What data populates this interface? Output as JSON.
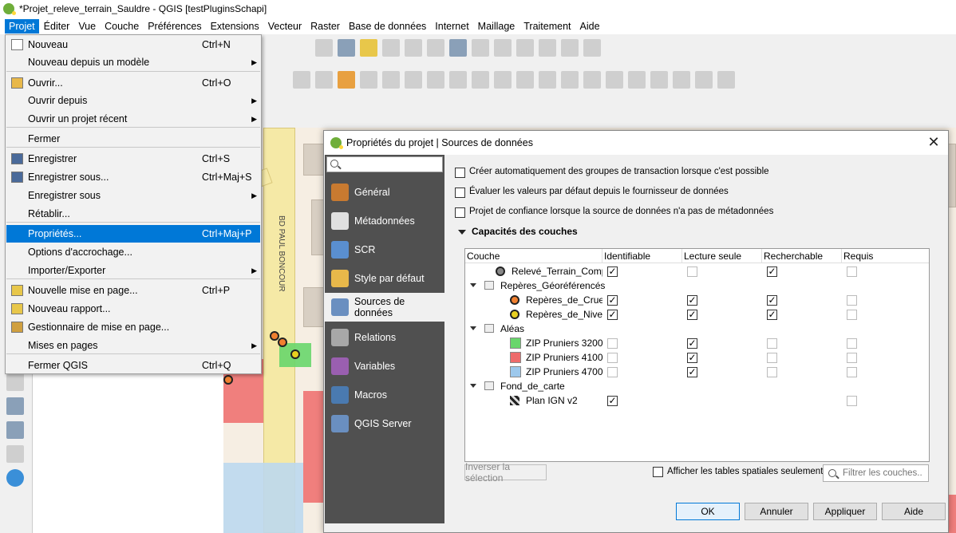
{
  "window": {
    "title": "*Projet_releve_terrain_Sauldre - QGIS [testPluginsSchapi]"
  },
  "menubar": [
    "Projet",
    "Éditer",
    "Vue",
    "Couche",
    "Préférences",
    "Extensions",
    "Vecteur",
    "Raster",
    "Base de données",
    "Internet",
    "Maillage",
    "Traitement",
    "Aide"
  ],
  "projet_menu": {
    "items": [
      {
        "label": "Nouveau",
        "shortcut": "Ctrl+N",
        "icon": "new-file-icon",
        "submenu": false
      },
      {
        "label": "Nouveau depuis un modèle",
        "shortcut": "",
        "icon": "",
        "submenu": true
      },
      {
        "label": "Ouvrir...",
        "shortcut": "Ctrl+O",
        "icon": "folder-icon",
        "submenu": false
      },
      {
        "label": "Ouvrir depuis",
        "shortcut": "",
        "icon": "",
        "submenu": true
      },
      {
        "label": "Ouvrir un projet récent",
        "shortcut": "",
        "icon": "",
        "submenu": true
      },
      {
        "label": "Fermer",
        "shortcut": "",
        "icon": "",
        "submenu": false
      },
      {
        "label": "Enregistrer",
        "shortcut": "Ctrl+S",
        "icon": "save-icon",
        "submenu": false
      },
      {
        "label": "Enregistrer sous...",
        "shortcut": "Ctrl+Maj+S",
        "icon": "save-as-icon",
        "submenu": false
      },
      {
        "label": "Enregistrer sous",
        "shortcut": "",
        "icon": "",
        "submenu": true
      },
      {
        "label": "Rétablir...",
        "shortcut": "",
        "icon": "",
        "submenu": false
      },
      {
        "label": "Propriétés...",
        "shortcut": "Ctrl+Maj+P",
        "icon": "",
        "submenu": false
      },
      {
        "label": "Options d'accrochage...",
        "shortcut": "",
        "icon": "",
        "submenu": false
      },
      {
        "label": "Importer/Exporter",
        "shortcut": "",
        "icon": "",
        "submenu": true
      },
      {
        "label": "Nouvelle mise en page...",
        "shortcut": "Ctrl+P",
        "icon": "layout-icon",
        "submenu": false
      },
      {
        "label": "Nouveau rapport...",
        "shortcut": "",
        "icon": "report-icon",
        "submenu": false
      },
      {
        "label": "Gestionnaire de mise en page...",
        "shortcut": "",
        "icon": "layout-manager-icon",
        "submenu": false
      },
      {
        "label": "Mises en pages",
        "shortcut": "",
        "icon": "",
        "submenu": true
      },
      {
        "label": "Fermer QGIS",
        "shortcut": "Ctrl+Q",
        "icon": "",
        "submenu": false
      }
    ]
  },
  "map": {
    "street_label": "BD PAUL BONCOUR"
  },
  "dialog": {
    "title": "Propriétés du projet | Sources de données",
    "sidebar": [
      {
        "label": "Général",
        "icon": "tools-icon",
        "color": "#c87a30"
      },
      {
        "label": "Métadonnées",
        "icon": "metadata-icon",
        "color": "#e0e0e0"
      },
      {
        "label": "SCR",
        "icon": "globe-icon",
        "color": "#5a8fd0"
      },
      {
        "label": "Style par défaut",
        "icon": "brush-icon",
        "color": "#e8b84a"
      },
      {
        "label": "Sources de données",
        "icon": "table-icon",
        "color": "#6a8fc0"
      },
      {
        "label": "Relations",
        "icon": "relations-icon",
        "color": "#a8a8a8"
      },
      {
        "label": "Variables",
        "icon": "variables-icon",
        "color": "#9a5fb0"
      },
      {
        "label": "Macros",
        "icon": "macros-icon",
        "color": "#4a7ab0"
      },
      {
        "label": "QGIS Server",
        "icon": "server-icon",
        "color": "#6a8fc0"
      }
    ],
    "options": [
      {
        "label": "Créer automatiquement des groupes de transaction lorsque c'est possible",
        "checked": false
      },
      {
        "label": "Évaluer les valeurs par défaut depuis le fournisseur de données",
        "checked": false
      },
      {
        "label": "Projet de confiance lorsque la source de données n'a pas de métadonnées",
        "checked": false
      }
    ],
    "section_title": "Capacités des couches",
    "columns": [
      "Couche",
      "Identifiable",
      "Lecture seule",
      "Recherchable",
      "Requis"
    ],
    "rows": [
      {
        "label": "Relevé_Terrain_Complet",
        "indent": 1,
        "type": "layer",
        "icon": "points-layer-icon",
        "color": "#888888",
        "id": true,
        "ro": false,
        "search": true,
        "req": false,
        "has_search": true
      },
      {
        "label": "Repères_Géoréférencés",
        "indent": 0,
        "type": "group",
        "icon": "group-icon",
        "color": "#888888"
      },
      {
        "label": "Repères_de_Crues",
        "indent": 2,
        "type": "layer",
        "icon": "orange-point-icon",
        "color": "#f08030",
        "id": true,
        "ro": true,
        "search": true,
        "req": false,
        "has_search": true
      },
      {
        "label": "Repères_de_Nivell...",
        "indent": 2,
        "type": "layer",
        "icon": "yellow-point-icon",
        "color": "#e8d020",
        "id": true,
        "ro": true,
        "search": true,
        "req": false,
        "has_search": true
      },
      {
        "label": "Aléas",
        "indent": 0,
        "type": "group",
        "icon": "group-icon",
        "color": "#888888"
      },
      {
        "label": "ZIP Pruniers 3200",
        "indent": 2,
        "type": "layer",
        "icon": "green-polygon-icon",
        "color": "#69d66c",
        "id": false,
        "ro": true,
        "search": false,
        "req": false,
        "has_search": true
      },
      {
        "label": "ZIP Pruniers 4100",
        "indent": 2,
        "type": "layer",
        "icon": "red-polygon-icon",
        "color": "#ee6b6b",
        "id": false,
        "ro": true,
        "search": false,
        "req": false,
        "has_search": true
      },
      {
        "label": "ZIP Pruniers 4700",
        "indent": 2,
        "type": "layer",
        "icon": "blue-polygon-icon",
        "color": "#9cc8ec",
        "id": false,
        "ro": true,
        "search": false,
        "req": false,
        "has_search": true
      },
      {
        "label": "Fond_de_carte",
        "indent": 0,
        "type": "group",
        "icon": "group-icon",
        "color": "#888888"
      },
      {
        "label": "Plan IGN v2",
        "indent": 2,
        "type": "layer",
        "icon": "raster-icon",
        "color": "#222222",
        "id": true,
        "ro": null,
        "search": null,
        "req": false,
        "has_search": false
      }
    ],
    "invert_button": "Inverser la sélection",
    "spatial_only": "Afficher les tables spatiales seulement",
    "filter_placeholder": "Filtrer les couches...",
    "buttons": {
      "ok": "OK",
      "cancel": "Annuler",
      "apply": "Appliquer",
      "help": "Aide"
    }
  }
}
